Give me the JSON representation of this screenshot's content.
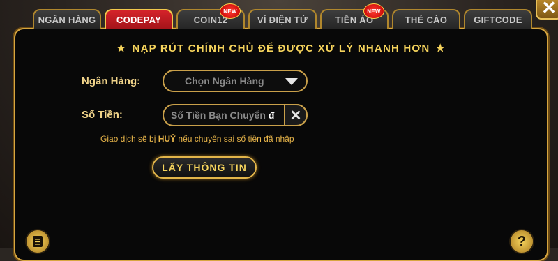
{
  "tabs": [
    {
      "label": "NGÂN HÀNG",
      "active": false,
      "new": false
    },
    {
      "label": "CODEPAY",
      "active": true,
      "new": false
    },
    {
      "label": "COIN12",
      "active": false,
      "new": true
    },
    {
      "label": "VÍ ĐIỆN TỬ",
      "active": false,
      "new": false
    },
    {
      "label": "TIỀN ẢO",
      "active": false,
      "new": true
    },
    {
      "label": "THẺ CÀO",
      "active": false,
      "new": false
    },
    {
      "label": "GIFTCODE",
      "active": false,
      "new": false
    }
  ],
  "badge_text": "NEW",
  "close_icon": "✕",
  "form": {
    "title": "NẠP RÚT CHÍNH CHỦ ĐỂ ĐƯỢC XỬ LÝ NHANH HƠN",
    "bank_label": "Ngân Hàng:",
    "bank_placeholder": "Chọn Ngân Hàng",
    "amount_label": "Số Tiền:",
    "amount_placeholder": "Số Tiền Bạn Chuyển",
    "amount_unit": "đ",
    "clear_icon": "✕",
    "hint_before": "Giao dịch sẽ bị ",
    "hint_strong": "HUỶ",
    "hint_after": " nếu chuyển sai số tiền đã nhập",
    "submit_label": "LẤY THÔNG TIN"
  },
  "colors": {
    "accent_gold": "#f5d35c",
    "active_tab": "#d4232a",
    "panel_bg": "#080808"
  },
  "icons": [
    "star-icon",
    "chevron-down-icon",
    "clear-icon",
    "menu-list-icon",
    "help-icon",
    "close-icon"
  ]
}
